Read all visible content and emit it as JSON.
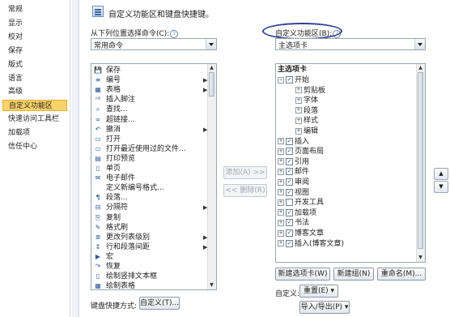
{
  "nav": {
    "items": [
      "常规",
      "显示",
      "校对",
      "保存",
      "版式",
      "语言",
      "高级",
      "自定义功能区",
      "快速访问工具栏",
      "加载项",
      "信任中心"
    ],
    "selected_index": 7
  },
  "header": {
    "text": "自定义功能区和键盘快捷键。"
  },
  "left_panel": {
    "label": "从下列位置选择命令(C):",
    "info": "i",
    "combo_value": "常用命令",
    "commands": [
      {
        "label": "保存",
        "icon": "save-icon",
        "sub": false
      },
      {
        "label": "编号",
        "icon": "numbering-icon",
        "sub": true
      },
      {
        "label": "表格",
        "icon": "table-icon",
        "sub": true
      },
      {
        "label": "插入脚注",
        "icon": "footnote-icon",
        "sub": false
      },
      {
        "label": "查找...",
        "icon": "find-icon",
        "sub": false
      },
      {
        "label": "超链接...",
        "icon": "hyperlink-icon",
        "sub": false
      },
      {
        "label": "撤消",
        "icon": "undo-icon",
        "sub": true
      },
      {
        "label": "打开",
        "icon": "open-icon",
        "sub": false
      },
      {
        "label": "打开最近使用过的文件...",
        "icon": "recent-file-icon",
        "sub": false
      },
      {
        "label": "打印预览",
        "icon": "print-preview-icon",
        "sub": false
      },
      {
        "label": "单页",
        "icon": "single-page-icon",
        "sub": false
      },
      {
        "label": "电子邮件",
        "icon": "email-icon",
        "sub": false
      },
      {
        "label": "定义新编号格式...",
        "icon": "blank-icon",
        "sub": false
      },
      {
        "label": "段落...",
        "icon": "paragraph-icon",
        "sub": false
      },
      {
        "label": "分隔符",
        "icon": "separator-icon",
        "sub": true
      },
      {
        "label": "复制",
        "icon": "copy-icon",
        "sub": false
      },
      {
        "label": "格式刷",
        "icon": "format-painter-icon",
        "sub": false
      },
      {
        "label": "更改列表级别",
        "icon": "list-level-icon",
        "sub": true
      },
      {
        "label": "行和段落间距",
        "icon": "line-spacing-icon",
        "sub": true
      },
      {
        "label": "宏",
        "icon": "macro-icon",
        "sub": false
      },
      {
        "label": "恢复",
        "icon": "redo-icon",
        "sub": false
      },
      {
        "label": "绘制竖排文本框",
        "icon": "vertical-textbox-icon",
        "sub": false
      },
      {
        "label": "绘制表格",
        "icon": "draw-table-icon",
        "sub": false
      }
    ]
  },
  "keyboard": {
    "label": "键盘快捷方式:",
    "button": "自定义(T)..."
  },
  "middle": {
    "add": "添加(A) >>",
    "remove": "<< 删除(R)"
  },
  "right_panel": {
    "label": "自定义功能区(B):",
    "info": "i",
    "combo_value": "主选项卡",
    "tree_header": "主选项卡",
    "tree": [
      {
        "label": "开始",
        "level": 0,
        "exp": "⊟",
        "checked": true
      },
      {
        "label": "剪贴板",
        "level": 1,
        "exp": "⊞",
        "checked": null
      },
      {
        "label": "字体",
        "level": 1,
        "exp": "⊞",
        "checked": null
      },
      {
        "label": "段落",
        "level": 1,
        "exp": "⊞",
        "checked": null
      },
      {
        "label": "样式",
        "level": 1,
        "exp": "⊞",
        "checked": null
      },
      {
        "label": "编辑",
        "level": 1,
        "exp": "⊞",
        "checked": null
      },
      {
        "label": "插入",
        "level": 0,
        "exp": "⊞",
        "checked": true
      },
      {
        "label": "页面布局",
        "level": 0,
        "exp": "⊞",
        "checked": true
      },
      {
        "label": "引用",
        "level": 0,
        "exp": "⊞",
        "checked": true
      },
      {
        "label": "邮件",
        "level": 0,
        "exp": "⊞",
        "checked": true
      },
      {
        "label": "审阅",
        "level": 0,
        "exp": "⊞",
        "checked": true
      },
      {
        "label": "视图",
        "level": 0,
        "exp": "⊞",
        "checked": true
      },
      {
        "label": "开发工具",
        "level": 0,
        "exp": "⊞",
        "checked": false
      },
      {
        "label": "加载项",
        "level": 0,
        "exp": "⊞",
        "checked": true
      },
      {
        "label": "书法",
        "level": 0,
        "exp": "⊞",
        "checked": true
      },
      {
        "label": "博客文章",
        "level": 0,
        "exp": "⊞",
        "checked": true
      },
      {
        "label": "插入(博客文章)",
        "level": 0,
        "exp": "⊞",
        "checked": true
      }
    ],
    "new_tab": "新建选项卡(W)",
    "new_group": "新建组(N)",
    "rename": "重命名(M)...",
    "customize_label": "自定义:",
    "reset": "重置(E) ▾",
    "import_export": "导入/导出(P) ▾"
  },
  "side_arrows": {
    "up": "▲",
    "down": "▼"
  },
  "colors": {
    "selected_bg": "#fcd36a",
    "annotation": "#2f3f97"
  }
}
